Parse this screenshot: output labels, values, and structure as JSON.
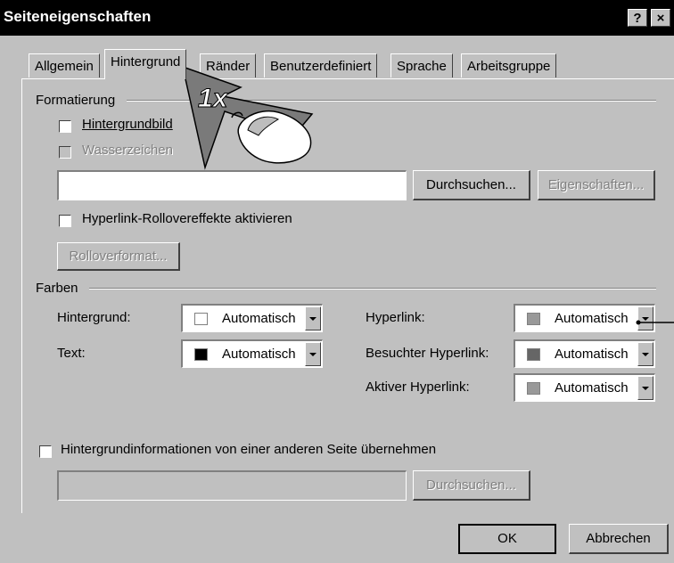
{
  "dialog": {
    "title": "Seiteneigenschaften",
    "help_button": "?",
    "close_button": "×"
  },
  "tabs": [
    "Allgemein",
    "Hintergrund",
    "Ränder",
    "Benutzerdefiniert",
    "Sprache",
    "Arbeitsgruppe"
  ],
  "active_tab": "Hintergrund",
  "formatting": {
    "group_label": "Formatierung",
    "background_image": {
      "label": "Hintergrundbild",
      "checked": false
    },
    "watermark": {
      "label": "Wasserzeichen",
      "checked": false,
      "disabled": true
    },
    "path_value": "",
    "browse_button": "Durchsuchen...",
    "properties_button": "Eigenschaften...",
    "hyperlink_rollover": {
      "label": "Hyperlink-Rollovereffekte aktivieren",
      "checked": false
    },
    "rollover_format_button": "Rolloverformat..."
  },
  "colors": {
    "group_label": "Farben",
    "background": {
      "label": "Hintergrund:",
      "value": "Automatisch",
      "swatch": "#ffffff"
    },
    "text": {
      "label": "Text:",
      "value": "Automatisch",
      "swatch": "#000000"
    },
    "hyperlink": {
      "label": "Hyperlink:",
      "value": "Automatisch",
      "swatch": "#999999"
    },
    "visited_hyperlink": {
      "label": "Besuchter Hyperlink:",
      "value": "Automatisch",
      "swatch": "#666666"
    },
    "active_hyperlink": {
      "label": "Aktiver Hyperlink:",
      "value": "Automatisch",
      "swatch": "#999999"
    }
  },
  "other_page": {
    "label": "Hintergrundinformationen von einer anderen Seite übernehmen",
    "checked": false,
    "path_value": "",
    "browse_button": "Durchsuchen..."
  },
  "footer": {
    "ok_button": "OK",
    "cancel_button": "Abbrechen"
  },
  "annotation": {
    "click_count": "1x"
  }
}
